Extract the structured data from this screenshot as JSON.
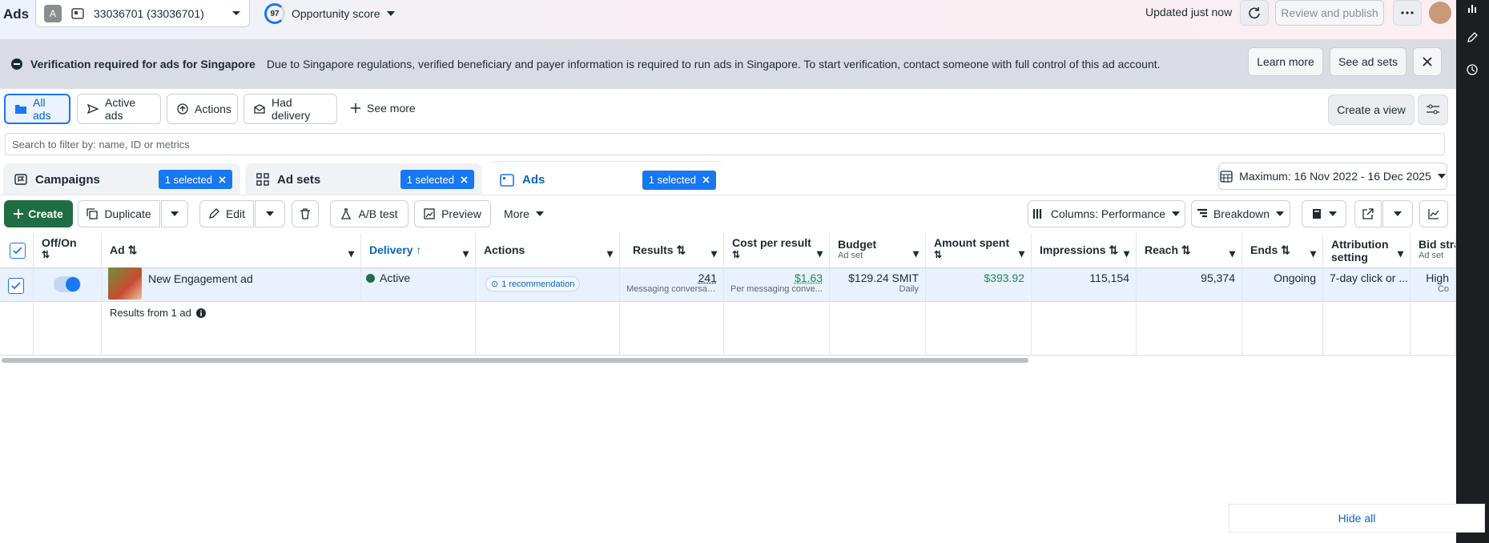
{
  "header": {
    "title": "Ads",
    "account_avatar": "A",
    "account_name": "33036701 (33036701)",
    "score_value": "97",
    "score_label": "Opportunity score",
    "updated": "Updated just now",
    "review_publish": "Review and publish"
  },
  "banner": {
    "title": "Verification required for ads for Singapore",
    "text": "Due to Singapore regulations, verified beneficiary and payer information is required to run ads in Singapore. To start verification, contact someone with full control of this ad account.",
    "learn_more": "Learn more",
    "see_ad_sets": "See ad sets"
  },
  "views": {
    "all_ads": "All ads",
    "active_ads": "Active ads",
    "actions": "Actions",
    "had_delivery": "Had delivery",
    "see_more": "See more",
    "create_view": "Create a view"
  },
  "search": {
    "placeholder": "Search to filter by: name, ID or metrics"
  },
  "levels": {
    "campaigns": "Campaigns",
    "ad_sets": "Ad sets",
    "ads": "Ads",
    "selected": "1 selected"
  },
  "date_range": "Maximum: 16 Nov 2022 - 16 Dec 2025",
  "toolbar": {
    "create": "Create",
    "duplicate": "Duplicate",
    "edit": "Edit",
    "ab_test": "A/B test",
    "preview": "Preview",
    "more": "More",
    "columns": "Columns: Performance",
    "breakdown": "Breakdown"
  },
  "table": {
    "headers": {
      "offon": "Off/On",
      "ad": "Ad",
      "delivery": "Delivery",
      "actions": "Actions",
      "results": "Results",
      "cpr": "Cost per result",
      "budget": "Budget",
      "budget_sub": "Ad set",
      "spent": "Amount spent",
      "impressions": "Impressions",
      "reach": "Reach",
      "ends": "Ends",
      "attribution": "Attribution setting",
      "bid": "Bid stra",
      "bid_sub": "Ad set"
    },
    "row": {
      "ad_name": "New Engagement ad",
      "delivery": "Active",
      "recommendation": "1 recommendation",
      "results": "241",
      "results_sub": "Messaging conversat...",
      "cpr": "$1.63",
      "cpr_sub": "Per messaging conve...",
      "budget": "$129.24 SMIT",
      "budget_sub": "Daily",
      "spent": "$393.92",
      "impressions": "115,154",
      "reach": "95,374",
      "ends": "Ongoing",
      "attribution": "7-day click or ...",
      "bid": "High",
      "bid_sub": "Co"
    },
    "footer": "Results from 1 ad"
  },
  "hide_all": "Hide all",
  "colors": {
    "accent": "#1877f2",
    "create": "#1f6e43",
    "spent": "#1a8d4e"
  }
}
